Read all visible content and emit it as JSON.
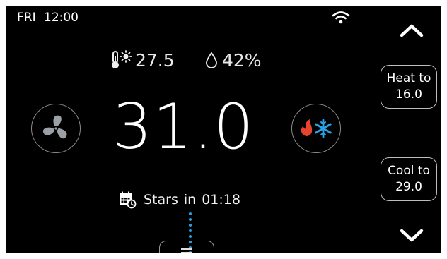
{
  "status": {
    "day": "FRI",
    "time": "12:00"
  },
  "environment": {
    "outdoor_temp": "27.5",
    "humidity": "42%"
  },
  "setpoint": {
    "whole": "31",
    "decimal": ".0"
  },
  "schedule": {
    "label": "Stars",
    "in": "in",
    "time": "01:18"
  },
  "side_controls": {
    "heat_label": "Heat to",
    "heat_value": "16.0",
    "cool_label": "Cool to",
    "cool_value": "29.0"
  },
  "icons": {
    "wifi": "wifi-icon",
    "thermometer": "thermometer-sun-icon",
    "humidity": "droplet-icon",
    "fan": "fan-icon",
    "mode": "heat-cool-icon",
    "schedule": "calendar-clock-icon",
    "menu": "menu-icon",
    "up": "chevron-up-icon",
    "down": "chevron-down-icon"
  },
  "colors": {
    "heat": "#e8432e",
    "cool": "#29a3e8",
    "dots": "#2b9fe0",
    "background": "#000000"
  }
}
